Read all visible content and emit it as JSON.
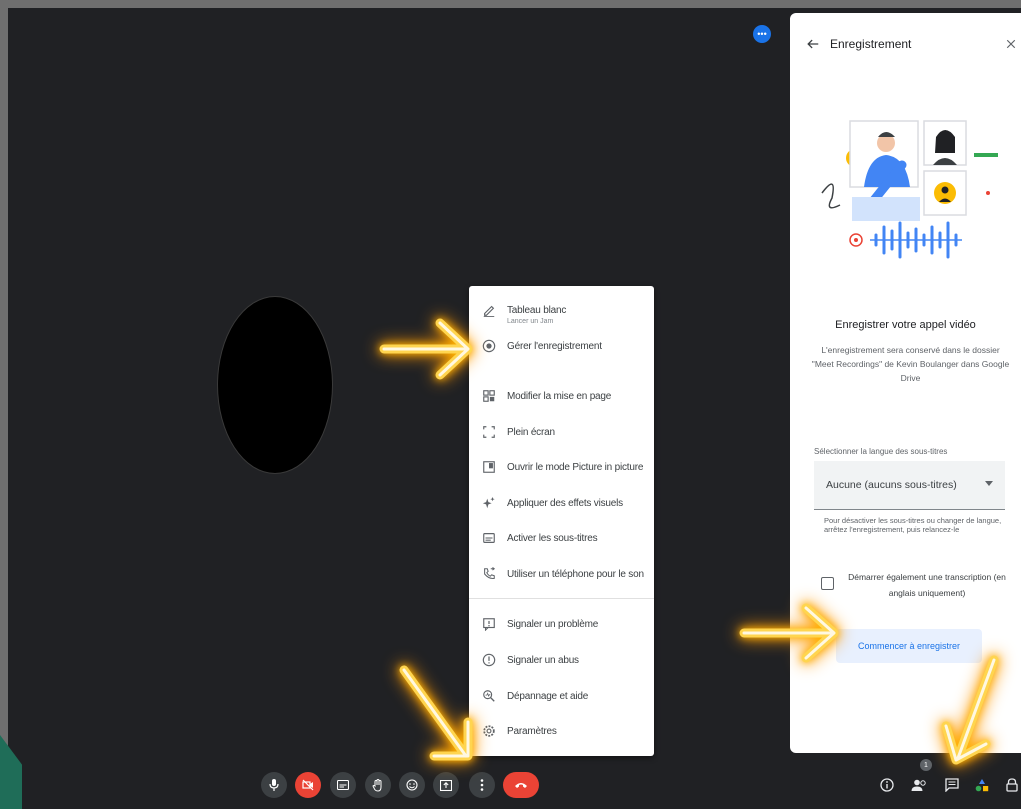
{
  "menu": {
    "items": [
      {
        "label": "Tableau blanc",
        "sub": "Lancer un Jam",
        "icon": "pen-icon"
      },
      {
        "label": "Gérer l'enregistrement",
        "icon": "record-icon"
      },
      {
        "label": "Modifier la mise en page",
        "icon": "layout-icon"
      },
      {
        "label": "Plein écran",
        "icon": "fullscreen-icon"
      },
      {
        "label": "Ouvrir le mode Picture in picture",
        "icon": "picture-in-picture-icon"
      },
      {
        "label": "Appliquer des effets visuels",
        "icon": "sparkle-icon"
      },
      {
        "label": "Activer les sous-titres",
        "icon": "captions-icon"
      },
      {
        "label": "Utiliser un téléphone pour le son",
        "icon": "phone-audio-icon"
      },
      {
        "label": "Signaler un problème",
        "icon": "report-problem-icon"
      },
      {
        "label": "Signaler un abus",
        "icon": "report-abuse-icon"
      },
      {
        "label": "Dépannage et aide",
        "icon": "troubleshoot-icon"
      },
      {
        "label": "Paramètres",
        "icon": "settings-icon"
      }
    ]
  },
  "panel": {
    "title": "Enregistrement",
    "heading": "Enregistrer votre appel vidéo",
    "description": "L'enregistrement sera conservé dans le dossier \"Meet Recordings\" de Kevin Boulanger dans Google Drive",
    "subtitle_label": "Sélectionner la langue des sous-titres",
    "subtitle_value": "Aucune (aucuns sous-titres)",
    "help": "Pour désactiver les sous-titres ou changer de langue, arrêtez l'enregistrement, puis relancez-le",
    "checkbox_label": "Démarrer également une transcription (en anglais uniquement)",
    "start_button": "Commencer à enregistrer"
  },
  "top_badge": "•••",
  "people_count": "1",
  "controls": [
    "mic-icon",
    "camera-off-icon",
    "captions-icon",
    "raise-hand-icon",
    "emoji-icon",
    "present-icon",
    "more-options-icon",
    "hang-up-icon"
  ],
  "right_controls": [
    "info-icon",
    "people-icon",
    "chat-icon",
    "activities-icon",
    "lock-icon"
  ],
  "colors": {
    "accent": "#1a73e8",
    "danger": "#ea4335",
    "background": "#202124",
    "annotation": "#ffb300"
  }
}
